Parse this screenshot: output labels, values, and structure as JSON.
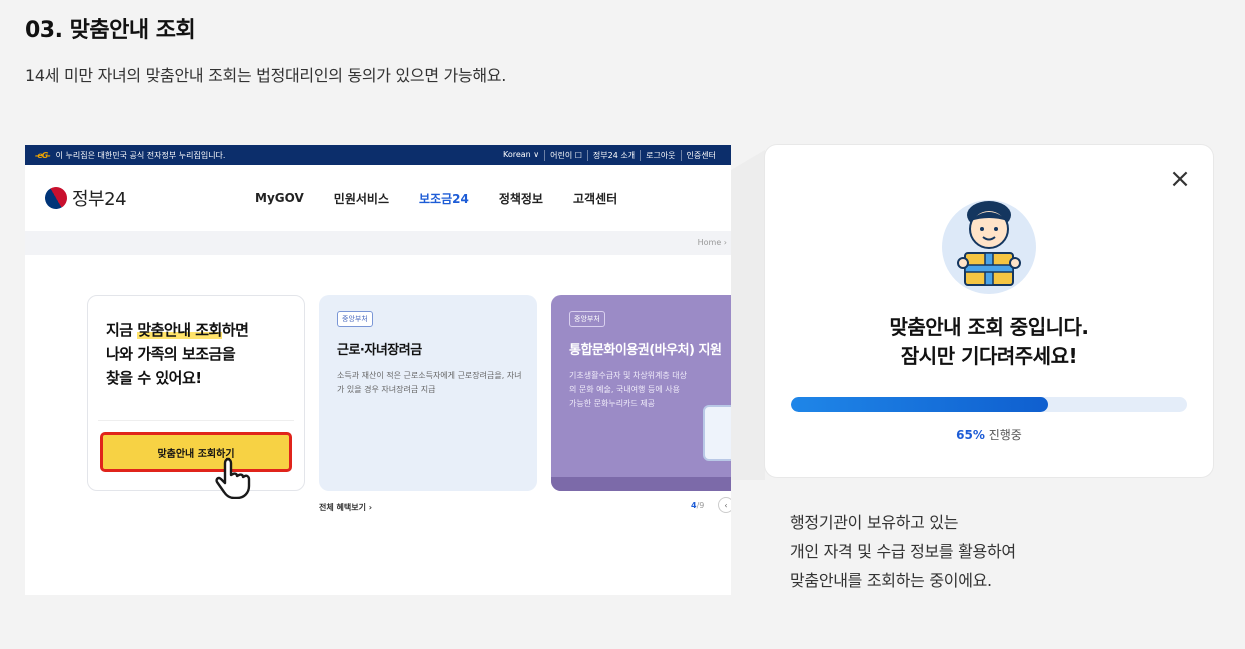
{
  "step": {
    "title": "03. 맞춤안내 조회",
    "description": "14세 미만 자녀의 맞춤안내 조회는 법정대리인의 동의가 있으면 가능해요."
  },
  "site": {
    "topbar": {
      "logo_text": "-eG-",
      "notice": "이 누리집은 대한민국 공식 전자정부 누리집입니다.",
      "utils": [
        "Korean ∨",
        "어린이 ☐",
        "정부24 소개",
        "로그아웃",
        "인증센터"
      ]
    },
    "logo": "정부24",
    "nav": [
      {
        "label": "MyGOV",
        "active": false
      },
      {
        "label": "민원서비스",
        "active": false
      },
      {
        "label": "보조금24",
        "active": true
      },
      {
        "label": "정책정보",
        "active": false
      },
      {
        "label": "고객센터",
        "active": false
      }
    ],
    "breadcrumb": "Home ›",
    "main_card": {
      "line1_pre": "지금 ",
      "line1_highlight": "맞춤안내 조회",
      "line1_post": "하면",
      "line2": "나와 가족의 보조금을",
      "line3": "찾을 수 있어요!",
      "button": "맞춤안내 조회하기"
    },
    "cards": [
      {
        "tag": "중앙부처",
        "title": "근로·자녀장려금",
        "desc": "소득과 재산이 적은 근로소득자에게 근로장려금을, 자녀가 있을 경우 자녀장려금 지급"
      },
      {
        "tag": "중앙부처",
        "title": "통합문화이용권(바우처) 지원",
        "desc": "기초생활수급자 및 차상위계층 대상의 문화 예술, 국내여행 등에 사용 가능한 문화누리카드 제공"
      }
    ],
    "more_link": "전체 혜택보기 ›",
    "pager": {
      "current": "4",
      "sep": "/",
      "total": "9",
      "prev": "‹"
    }
  },
  "modal": {
    "close": "×",
    "message_line1": "맞춤안내 조회 중입니다.",
    "message_line2": "잠시만 기다려주세요!",
    "progress_percent": 65,
    "progress_label_pct": "65%",
    "progress_label_text": " 진행중"
  },
  "side_description": {
    "line1": "행정기관이 보유하고 있는",
    "line2": "개인 자격 및 수급 정보를 활용하여",
    "line3": "맞춤안내를 조회하는 중이에요."
  },
  "colors": {
    "accent_blue": "#1d5cd6",
    "cta_yellow": "#f7d244",
    "cta_border_red": "#e0241b",
    "topbar_navy": "#0c2e6b",
    "card_purple": "#9b8bc6"
  }
}
